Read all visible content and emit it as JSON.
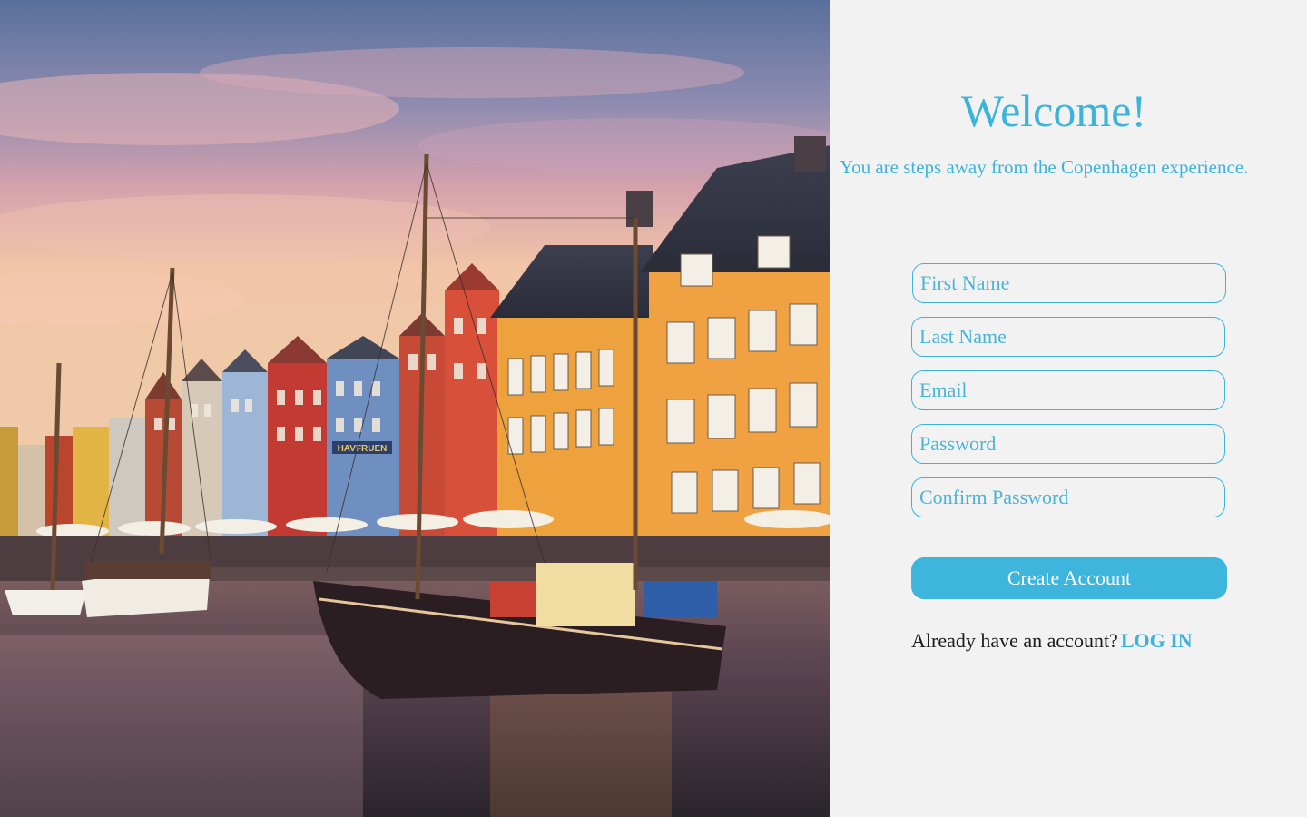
{
  "hero": {
    "image_icon": "harbor-photo-icon",
    "sign_text": "HAVFRUEN"
  },
  "signup": {
    "title": "Welcome!",
    "subtitle": "You are steps away from the Copenhagen experience.",
    "fields": {
      "first_name_placeholder": "First Name",
      "last_name_placeholder": "Last Name",
      "email_placeholder": "Email",
      "password_placeholder": "Password",
      "confirm_password_placeholder": "Confirm Password"
    },
    "create_button_label": "Create Account",
    "login_prompt": "Already have an account?",
    "login_link": "LOG IN"
  },
  "colors": {
    "accent": "#3bb4dc",
    "panel_background": "#f2f2f2",
    "text_dark": "#1a1a1a"
  }
}
